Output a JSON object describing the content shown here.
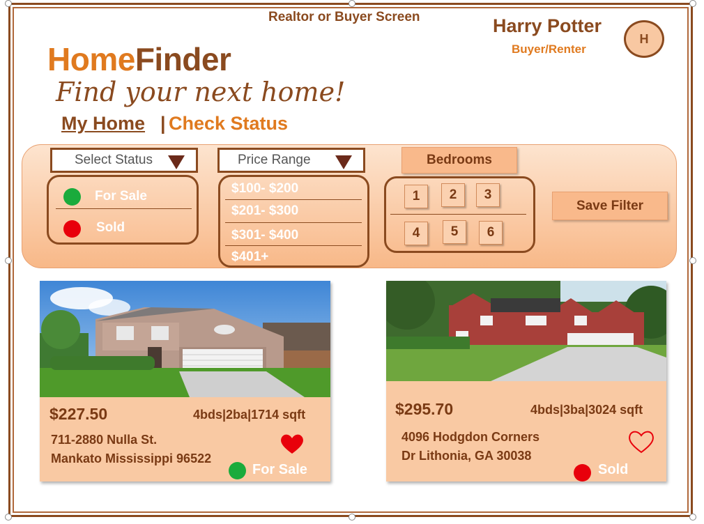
{
  "header": {
    "screen_title": "Realtor or Buyer Screen",
    "user_name": "Harry Potter",
    "user_role": "Buyer/Renter",
    "avatar_initial": "H"
  },
  "brand": {
    "logo_part1": "Home",
    "logo_part2": "Finder",
    "tagline": "Find your next home!"
  },
  "nav": {
    "home": "My Home ",
    "separator": "|",
    "check_status": "Check Status"
  },
  "filters": {
    "status": {
      "placeholder": "Select Status",
      "options": [
        {
          "label": "For Sale",
          "color": "#1aab3c"
        },
        {
          "label": "Sold",
          "color": "#e8000b"
        }
      ]
    },
    "price": {
      "placeholder": "Price Range",
      "options": [
        "$100- $200",
        "$201- $300",
        "$301- $400",
        "$401+"
      ]
    },
    "bedrooms": {
      "label": "Bedrooms",
      "options": [
        "1",
        "2",
        "3",
        "4",
        "5",
        "6"
      ]
    },
    "save_label": "Save Filter"
  },
  "listings": [
    {
      "price": "$227.50",
      "specs": "4bds|2ba|1714 sqft",
      "address_line1": "711-2880 Nulla St.",
      "address_line2": "Mankato Mississippi 96522",
      "status": "For Sale",
      "status_color": "#1aab3c",
      "favorite": true
    },
    {
      "price": "$295.70",
      "specs": "4bds|3ba|3024 sqft",
      "address_line1": "4096 Hodgdon Corners",
      "address_line2": "Dr Lithonia, GA 30038",
      "status": "Sold",
      "status_color": "#e8000b",
      "favorite": false
    }
  ]
}
